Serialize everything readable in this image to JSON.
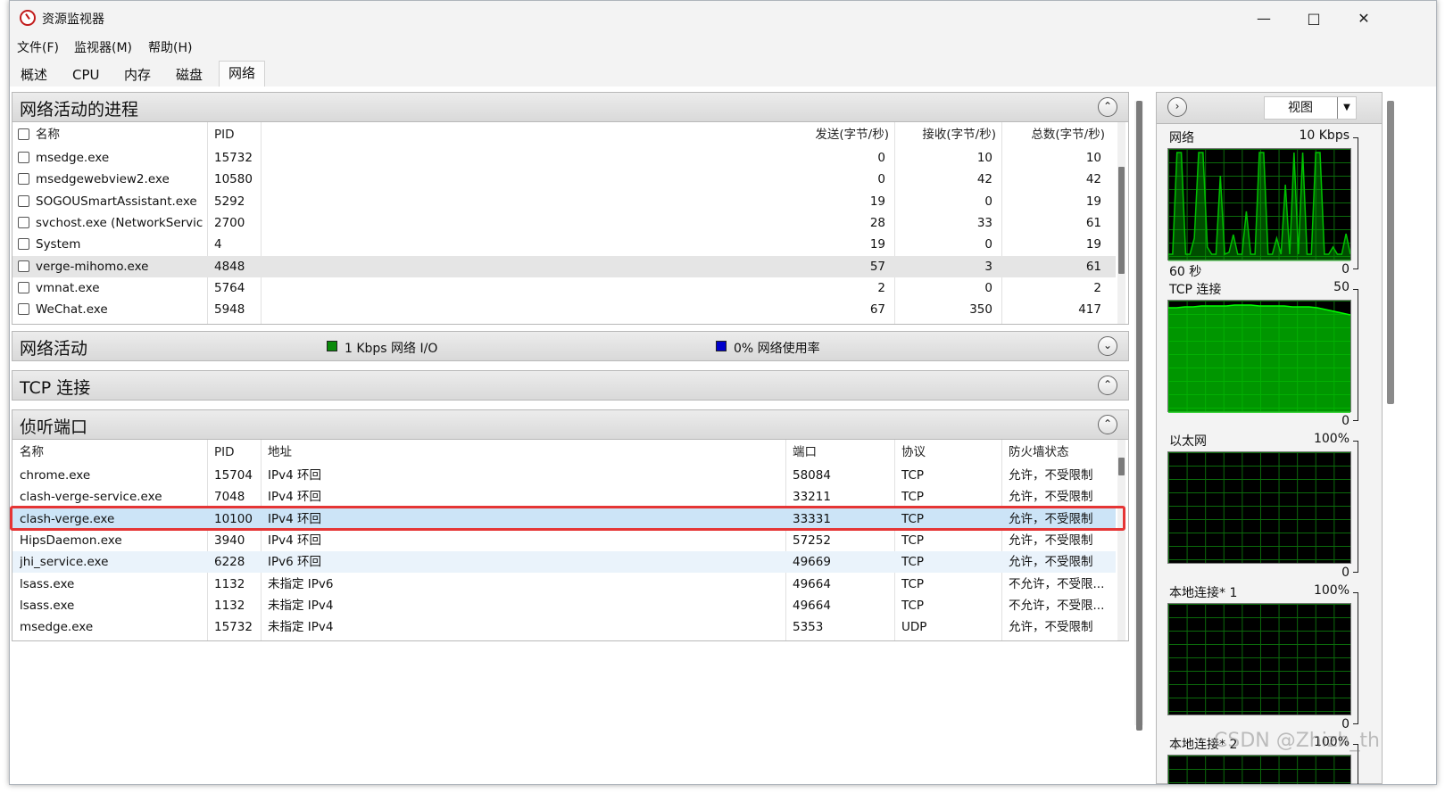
{
  "window": {
    "title": "资源监视器"
  },
  "menu": [
    "文件(F)",
    "监视器(M)",
    "帮助(H)"
  ],
  "tabs": [
    "概述",
    "CPU",
    "内存",
    "磁盘",
    "网络"
  ],
  "active_tab": "网络",
  "processes_section": {
    "title": "网络活动的进程",
    "columns": [
      "名称",
      "PID",
      "发送(字节/秒)",
      "接收(字节/秒)",
      "总数(字节/秒)"
    ],
    "rows": [
      {
        "name": "msedge.exe",
        "pid": "15732",
        "send": "0",
        "recv": "10",
        "total": "10"
      },
      {
        "name": "msedgewebview2.exe",
        "pid": "10580",
        "send": "0",
        "recv": "42",
        "total": "42"
      },
      {
        "name": "SOGOUSmartAssistant.exe",
        "pid": "5292",
        "send": "19",
        "recv": "0",
        "total": "19"
      },
      {
        "name": "svchost.exe (NetworkService...",
        "pid": "2700",
        "send": "28",
        "recv": "33",
        "total": "61"
      },
      {
        "name": "System",
        "pid": "4",
        "send": "19",
        "recv": "0",
        "total": "19"
      },
      {
        "name": "verge-mihomo.exe",
        "pid": "4848",
        "send": "57",
        "recv": "3",
        "total": "61"
      },
      {
        "name": "vmnat.exe",
        "pid": "5764",
        "send": "2",
        "recv": "0",
        "total": "2"
      },
      {
        "name": "WeChat.exe",
        "pid": "5948",
        "send": "67",
        "recv": "350",
        "total": "417"
      }
    ]
  },
  "network_activity": {
    "title": "网络活动",
    "io_label": "1 Kbps 网络 I/O",
    "usage_label": "0% 网络使用率",
    "io_color": "#0a8a0a",
    "usage_color": "#0000cc"
  },
  "tcp_section": {
    "title": "TCP 连接"
  },
  "listen_section": {
    "title": "侦听端口",
    "columns": [
      "名称",
      "PID",
      "地址",
      "端口",
      "协议",
      "防火墙状态"
    ],
    "rows": [
      {
        "name": "chrome.exe",
        "pid": "15704",
        "addr": "IPv4 环回",
        "port": "58084",
        "proto": "TCP",
        "fw": "允许，不受限制"
      },
      {
        "name": "clash-verge-service.exe",
        "pid": "7048",
        "addr": "IPv4 环回",
        "port": "33211",
        "proto": "TCP",
        "fw": "允许，不受限制"
      },
      {
        "name": "clash-verge.exe",
        "pid": "10100",
        "addr": "IPv4 环回",
        "port": "33331",
        "proto": "TCP",
        "fw": "允许，不受限制"
      },
      {
        "name": "HipsDaemon.exe",
        "pid": "3940",
        "addr": "IPv4 环回",
        "port": "57252",
        "proto": "TCP",
        "fw": "允许，不受限制"
      },
      {
        "name": "jhi_service.exe",
        "pid": "6228",
        "addr": "IPv6 环回",
        "port": "49669",
        "proto": "TCP",
        "fw": "允许，不受限制"
      },
      {
        "name": "lsass.exe",
        "pid": "1132",
        "addr": "未指定 IPv6",
        "port": "49664",
        "proto": "TCP",
        "fw": "不允许，不受限..."
      },
      {
        "name": "lsass.exe",
        "pid": "1132",
        "addr": "未指定 IPv4",
        "port": "49664",
        "proto": "TCP",
        "fw": "不允许，不受限..."
      },
      {
        "name": "msedge.exe",
        "pid": "15732",
        "addr": "未指定 IPv4",
        "port": "5353",
        "proto": "UDP",
        "fw": "允许，不受限制"
      }
    ]
  },
  "right_panel": {
    "view_label": "视图",
    "graphs": [
      {
        "title": "网络",
        "max": "10 Kbps",
        "bottom_left": "60 秒",
        "min": "0"
      },
      {
        "title": "TCP 连接",
        "max": "50",
        "bottom_left": "",
        "min": "0"
      },
      {
        "title": "以太网",
        "max": "100%",
        "bottom_left": "",
        "min": "0"
      },
      {
        "title": "本地连接* 1",
        "max": "100%",
        "bottom_left": "",
        "min": "0"
      },
      {
        "title": "本地连接* 2",
        "max": "100%",
        "bottom_left": "",
        "min": ""
      }
    ],
    "graph_color": "#00c000"
  },
  "watermark": "CSDN @Zhizh_th"
}
